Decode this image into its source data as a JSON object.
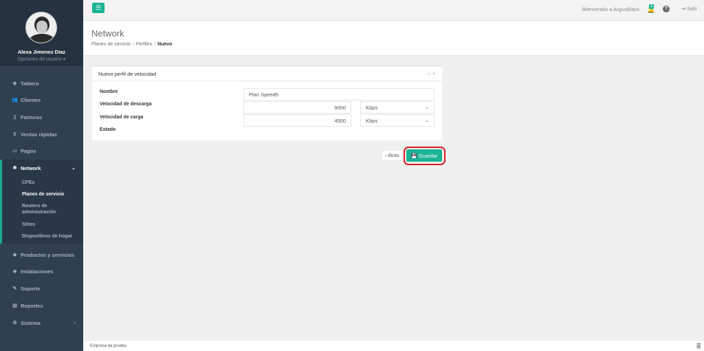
{
  "sidebar": {
    "user_name": "Alexa Jimenez Diaz",
    "user_options": "Opciones de usuario ▾",
    "items": [
      {
        "icon": "dashboard-icon",
        "glyph": "◈",
        "label": "Tablero"
      },
      {
        "icon": "users-icon",
        "glyph": "👥",
        "label": "Clientes"
      },
      {
        "icon": "file-icon",
        "glyph": "▯",
        "label": "Facturas"
      },
      {
        "icon": "dollar-icon",
        "glyph": "$",
        "label": "Ventas rápidas"
      },
      {
        "icon": "money-icon",
        "glyph": "▭",
        "label": "Pagos"
      },
      {
        "icon": "network-icon",
        "glyph": "❄",
        "label": "Network"
      },
      {
        "icon": "tags-icon",
        "glyph": "◆",
        "label": "Productos y servicios"
      },
      {
        "icon": "install-icon",
        "glyph": "◈",
        "label": "Instalaciones"
      },
      {
        "icon": "wrench-icon",
        "glyph": "✎",
        "label": "Soporte"
      },
      {
        "icon": "book-icon",
        "glyph": "▤",
        "label": "Reportes"
      },
      {
        "icon": "cogs-icon",
        "glyph": "⚙",
        "label": "Sistema"
      }
    ],
    "network_submenu": [
      "CPEs",
      "Planes de servicio",
      "Routers de administración",
      "Sitios",
      "Dispositivos de hogar"
    ]
  },
  "topbar": {
    "menu_icon": "☰",
    "welcome": "Bienvenido a ArgusBlack",
    "notification_count": "1",
    "help_icon": "?",
    "logout_label": "⇥ Salir"
  },
  "heading": {
    "title": "Network",
    "breadcrumb": [
      "Planes de servicio",
      "Perfiles",
      "Nuevo"
    ]
  },
  "panel": {
    "title": "Nuevo perfil de velocidad",
    "tools": "▭ ✕",
    "fields": {
      "nombre_label": "Nombre",
      "nombre_value": "Plan Speed5",
      "descarga_label": "Velocidad de descarga",
      "descarga_value": "9000",
      "descarga_unit": "Kbps",
      "carga_label": "Velocidad de carga",
      "carga_value": "4500",
      "carga_unit": "Kbps",
      "estado_label": "Estado"
    }
  },
  "actions": {
    "back_label": "‹ Atras",
    "save_label": "💾 Guardar"
  },
  "footer": {
    "text": "Empresa de prueba",
    "icon": "≣"
  },
  "colors": {
    "sidebar": "#2f4050",
    "accent": "#1ab394",
    "highlight_ring": "#d9181f"
  }
}
